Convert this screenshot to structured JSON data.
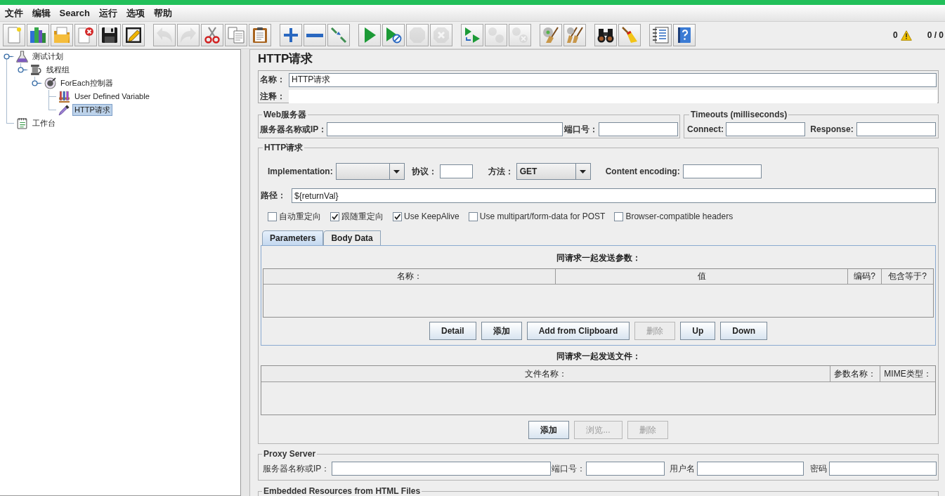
{
  "menu": [
    "文件",
    "编辑",
    "Search",
    "运行",
    "选项",
    "帮助"
  ],
  "toolbar": {
    "groups": [
      [
        {
          "disabled": false
        },
        {
          "disabled": false
        },
        {
          "disabled": false
        },
        {
          "disabled": false
        },
        {
          "disabled": false
        },
        {
          "disabled": false
        }
      ],
      [
        {
          "disabled": true
        },
        {
          "disabled": true
        },
        {
          "disabled": false
        },
        {
          "disabled": false
        },
        {
          "disabled": false
        }
      ],
      [
        {
          "disabled": false
        },
        {
          "disabled": false
        },
        {
          "disabled": false
        }
      ],
      [
        {
          "disabled": false
        },
        {
          "disabled": false
        },
        {
          "disabled": true
        },
        {
          "disabled": true
        }
      ],
      [
        {
          "disabled": false
        },
        {
          "disabled": true
        },
        {
          "disabled": true
        }
      ],
      [
        {
          "disabled": false
        },
        {
          "disabled": false
        }
      ],
      [
        {
          "disabled": false
        },
        {
          "disabled": false
        }
      ],
      [
        {
          "disabled": false
        },
        {
          "disabled": false
        }
      ]
    ],
    "warning_count": "0",
    "thread_count": "0 / 0"
  },
  "tree": {
    "items": [
      {
        "label": "测试计划",
        "kind": "test_plan",
        "selected": false,
        "children": [
          {
            "label": "线程组",
            "kind": "thread_group",
            "selected": false,
            "children": [
              {
                "label": "ForEach控制器",
                "kind": "controller",
                "selected": false,
                "children": [
                  {
                    "label": "User Defined Variable",
                    "kind": "config",
                    "selected": false
                  },
                  {
                    "label": "HTTP请求",
                    "kind": "sampler",
                    "selected": true
                  }
                ]
              }
            ]
          }
        ]
      },
      {
        "label": "工作台",
        "kind": "workbench",
        "selected": false
      }
    ]
  },
  "editor": {
    "title": "HTTP请求",
    "name_label": "名称：",
    "name_value": "HTTP请求",
    "comment_label": "注释："
  },
  "web_server": {
    "legend": "Web服务器",
    "server_label": "服务器名称或IP：",
    "port_label": "端口号："
  },
  "timeouts": {
    "legend": "Timeouts (milliseconds)",
    "connect_label": "Connect:",
    "response_label": "Response:"
  },
  "http_request": {
    "legend": "HTTP请求",
    "implementation_label": "Implementation:",
    "protocol_label": "协议：",
    "method_label": "方法：",
    "method_value": "GET",
    "encoding_label": "Content encoding:",
    "path_label": "路径：",
    "path_value": "${returnVal}",
    "options": [
      {
        "label": "自动重定向",
        "checked": false
      },
      {
        "label": "跟随重定向",
        "checked": true
      },
      {
        "label": "Use KeepAlive",
        "checked": true
      },
      {
        "label": "Use multipart/form-data for POST",
        "checked": false
      },
      {
        "label": "Browser-compatible headers",
        "checked": false
      }
    ],
    "tabs": [
      {
        "label": "Parameters",
        "selected": true
      },
      {
        "label": "Body Data",
        "selected": false
      }
    ],
    "parameters": {
      "caption": "同请求一起发送参数：",
      "columns": [
        "名称：",
        "值",
        "编码?",
        "包含等于?"
      ],
      "buttons": [
        {
          "label": "Detail",
          "disabled": false
        },
        {
          "label": "添加",
          "disabled": false
        },
        {
          "label": "Add from Clipboard",
          "disabled": false
        },
        {
          "label": "删除",
          "disabled": true
        },
        {
          "label": "Up",
          "disabled": false
        },
        {
          "label": "Down",
          "disabled": false
        }
      ]
    },
    "files": {
      "caption": "同请求一起发送文件：",
      "columns": [
        "文件名称：",
        "参数名称：",
        "MIME类型："
      ],
      "buttons": [
        {
          "label": "添加",
          "disabled": false
        },
        {
          "label": "浏览...",
          "disabled": true
        },
        {
          "label": "删除",
          "disabled": true
        }
      ]
    }
  },
  "proxy": {
    "legend": "Proxy Server",
    "fields": [
      {
        "label": "服务器名称或IP："
      },
      {
        "label": "端口号："
      },
      {
        "label": "用户名"
      },
      {
        "label": "密码"
      }
    ]
  },
  "embedded": {
    "legend": "Embedded Resources from HTML Files"
  }
}
